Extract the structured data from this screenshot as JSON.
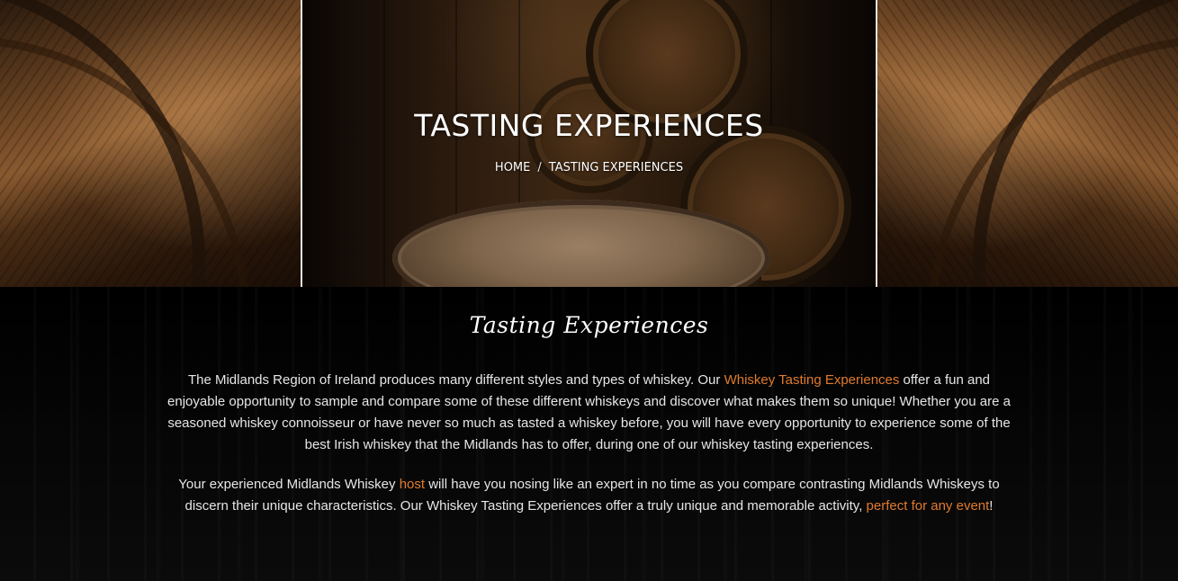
{
  "hero": {
    "title": "TASTING EXPERIENCES",
    "breadcrumb": {
      "home": "HOME",
      "separator": "/",
      "current": "TASTING EXPERIENCES"
    }
  },
  "content": {
    "heading": "Tasting Experiences",
    "paragraph1": {
      "before": "The Midlands Region of Ireland produces many different styles and types of whiskey. Our ",
      "link": "Whiskey Tasting Experiences",
      "after": " offer a fun and enjoyable opportunity to sample and compare some of these different whiskeys and discover what makes them so unique! Whether you are a seasoned whiskey connoisseur or have never so much as tasted a whiskey before, you will have every opportunity to experience some of the best Irish whiskey that the Midlands has to offer, during one of our whiskey tasting experiences."
    },
    "paragraph2": {
      "before": "Your experienced Midlands Whiskey ",
      "link1": "host",
      "middle": " will have you nosing like an expert in no time as you compare contrasting Midlands Whiskeys to discern their unique characteristics. Our Whiskey Tasting Experiences offer a truly unique and memorable activity, ",
      "link2": "perfect for any event",
      "after": "!"
    }
  },
  "colors": {
    "link": "#e07a2e",
    "text": "#e6e6e6",
    "background": "#050505"
  }
}
